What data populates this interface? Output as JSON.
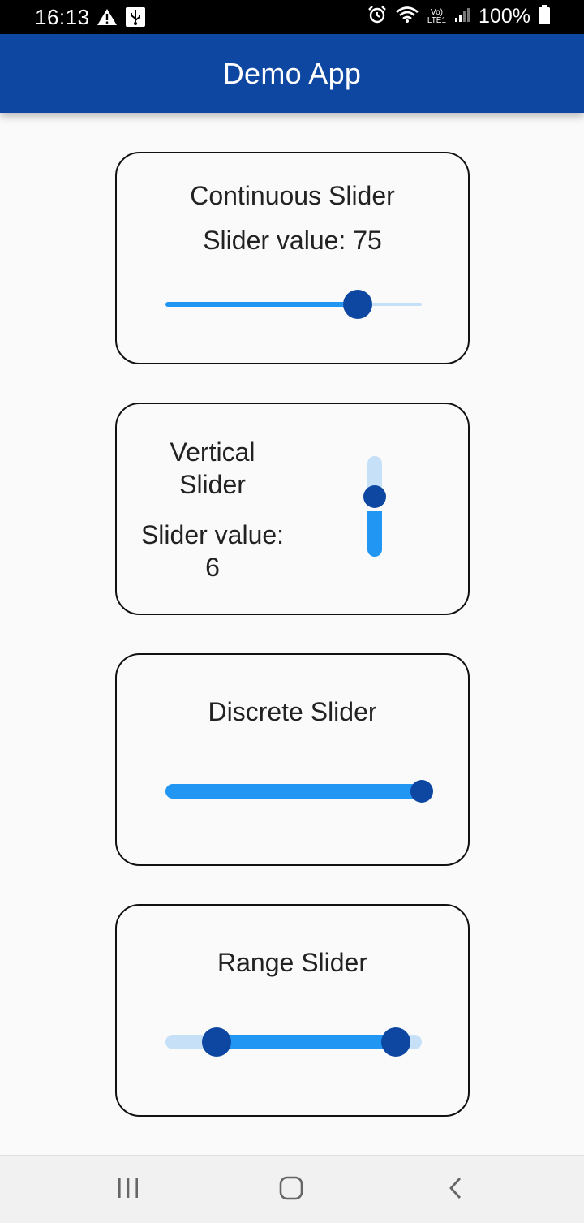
{
  "status_bar": {
    "time": "16:13",
    "battery": "100%",
    "icons": [
      "warning-icon",
      "usb-icon",
      "alarm-icon",
      "wifi-icon",
      "volte-icon",
      "signal-icon",
      "battery-icon"
    ],
    "network_label": "LTE1",
    "volte_label": "Vo)"
  },
  "app_bar": {
    "title": "Demo App"
  },
  "colors": {
    "primary": "#0d47a1",
    "slider_active": "#2196f3",
    "slider_inactive": "#c6e0f7"
  },
  "continuous_slider": {
    "title": "Continuous Slider",
    "value_text": "Slider value: 75",
    "value": 75,
    "min": 0,
    "max": 100
  },
  "vertical_slider": {
    "title_line1": "Vertical",
    "title_line2": "Slider",
    "value_line1": "Slider value:",
    "value_line2": "6",
    "value": 6,
    "min": 0,
    "max": 10
  },
  "discrete_slider": {
    "title": "Discrete Slider",
    "value_fraction": 1.0
  },
  "range_slider": {
    "title": "Range Slider",
    "start_fraction": 0.2,
    "end_fraction": 0.9
  },
  "nav_bar": {
    "buttons": [
      "recent-apps",
      "home",
      "back"
    ]
  }
}
